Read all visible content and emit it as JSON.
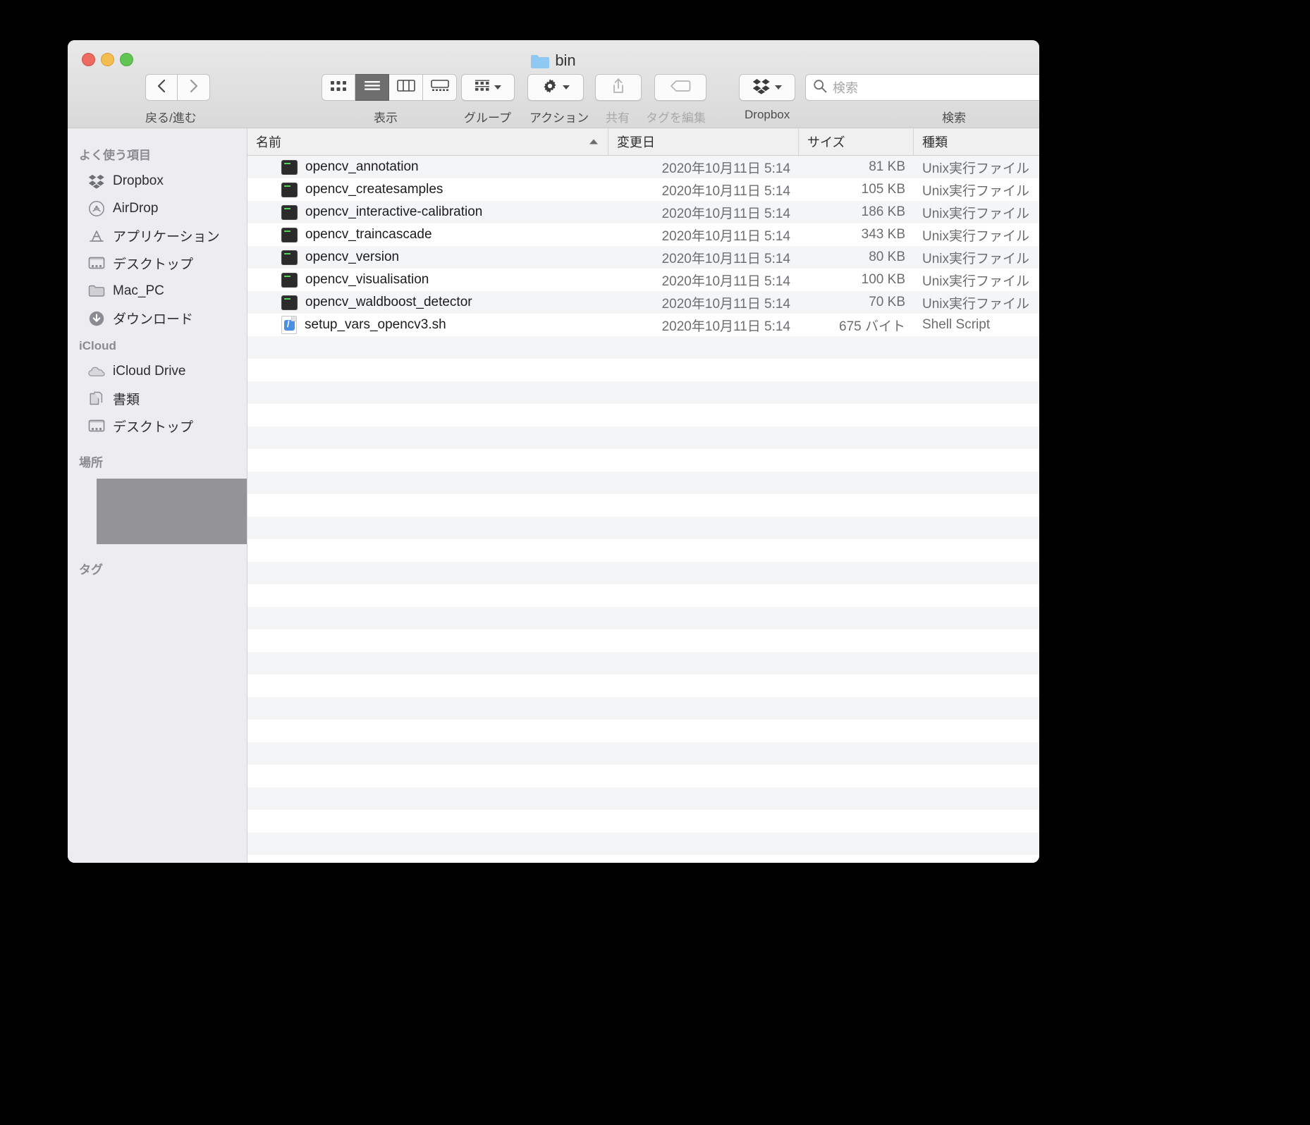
{
  "window": {
    "title": "bin",
    "folder_icon": "folder-icon",
    "traffic_lights": [
      "close-button",
      "minimize-button",
      "zoom-button"
    ]
  },
  "toolbar": {
    "nav": {
      "back_icon": "chevron-left-icon",
      "forward_icon": "chevron-right-icon",
      "label": "戻る/進む"
    },
    "view": {
      "label": "表示",
      "options": [
        "icon-view",
        "list-view",
        "column-view",
        "gallery-view"
      ],
      "selected": "list-view"
    },
    "group": {
      "label": "グループ",
      "icon": "group-icon"
    },
    "action": {
      "label": "アクション",
      "icon": "gear-icon"
    },
    "share": {
      "label": "共有",
      "icon": "share-icon",
      "disabled": true
    },
    "tags": {
      "label": "タグを編集",
      "icon": "tag-icon",
      "disabled": true
    },
    "dropbox": {
      "label": "Dropbox",
      "icon": "dropbox-icon"
    },
    "search": {
      "label": "検索",
      "placeholder": "検索",
      "value": "",
      "icon": "search-icon"
    }
  },
  "sidebar": {
    "sections": [
      {
        "title": "よく使う項目",
        "items": [
          {
            "label": "Dropbox",
            "icon": "dropbox-icon"
          },
          {
            "label": "AirDrop",
            "icon": "airdrop-icon"
          },
          {
            "label": "アプリケーション",
            "icon": "applications-icon"
          },
          {
            "label": "デスクトップ",
            "icon": "desktop-icon"
          },
          {
            "label": "Mac_PC",
            "icon": "folder-icon"
          },
          {
            "label": "ダウンロード",
            "icon": "downloads-icon"
          }
        ]
      },
      {
        "title": "iCloud",
        "items": [
          {
            "label": "iCloud Drive",
            "icon": "icloud-icon"
          },
          {
            "label": "書類",
            "icon": "documents-icon"
          },
          {
            "label": "デスクトップ",
            "icon": "desktop-icon"
          }
        ]
      },
      {
        "title": "場所",
        "items": [],
        "redacted_block": true
      },
      {
        "title": "タグ",
        "items": []
      }
    ]
  },
  "filelist": {
    "columns": [
      {
        "key": "name",
        "label": "名前",
        "sorted": "asc"
      },
      {
        "key": "date",
        "label": "変更日",
        "sorted": ""
      },
      {
        "key": "size",
        "label": "サイズ",
        "sorted": ""
      },
      {
        "key": "kind",
        "label": "種類",
        "sorted": ""
      }
    ],
    "rows": [
      {
        "name": "opencv_annotation",
        "date": "2020年10月11日 5:14",
        "size": "81 KB",
        "kind": "Unix実行ファイル",
        "icon": "unix-executable-icon"
      },
      {
        "name": "opencv_createsamples",
        "date": "2020年10月11日 5:14",
        "size": "105 KB",
        "kind": "Unix実行ファイル",
        "icon": "unix-executable-icon"
      },
      {
        "name": "opencv_interactive-calibration",
        "date": "2020年10月11日 5:14",
        "size": "186 KB",
        "kind": "Unix実行ファイル",
        "icon": "unix-executable-icon"
      },
      {
        "name": "opencv_traincascade",
        "date": "2020年10月11日 5:14",
        "size": "343 KB",
        "kind": "Unix実行ファイル",
        "icon": "unix-executable-icon"
      },
      {
        "name": "opencv_version",
        "date": "2020年10月11日 5:14",
        "size": "80 KB",
        "kind": "Unix実行ファイル",
        "icon": "unix-executable-icon"
      },
      {
        "name": "opencv_visualisation",
        "date": "2020年10月11日 5:14",
        "size": "100 KB",
        "kind": "Unix実行ファイル",
        "icon": "unix-executable-icon"
      },
      {
        "name": "opencv_waldboost_detector",
        "date": "2020年10月11日 5:14",
        "size": "70 KB",
        "kind": "Unix実行ファイル",
        "icon": "unix-executable-icon"
      },
      {
        "name": "setup_vars_opencv3.sh",
        "date": "2020年10月11日 5:14",
        "size": "675 バイト",
        "kind": "Shell Script",
        "icon": "shell-script-icon"
      }
    ],
    "empty_row_count": 23
  },
  "colors": {
    "window_chrome": "#dcdcdc",
    "sidebar_bg": "#ececeF1",
    "folder_blue": "#8fc8f0",
    "selected_segment": "#6e6e6e",
    "redaction_gray": "#949496"
  }
}
